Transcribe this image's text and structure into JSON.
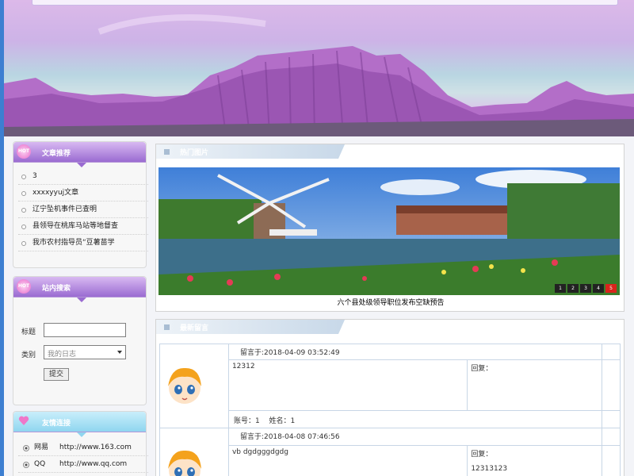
{
  "sidebar": {
    "articles": {
      "badge": "HOT",
      "title": "文章推荐",
      "items": [
        "3",
        "xxxxyyuj文章",
        "辽宁坠机事件已查明",
        "县领导在桃库马站等地督查",
        "我市农村指导员“豆薯苗学"
      ]
    },
    "search": {
      "badge": "HOT",
      "title": "站内搜索",
      "title_label": "标题",
      "title_value": "",
      "category_label": "类别",
      "category_value": "我的日志",
      "submit_label": "提交"
    },
    "links": {
      "title": "友情连接",
      "items": [
        {
          "name": "网易",
          "url": "http://www.163.com"
        },
        {
          "name": "QQ",
          "url": "http://www.qq.com"
        }
      ]
    }
  },
  "hot_pics": {
    "title": "热门图片",
    "caption": "六个县处级领导职位发布空缺预告",
    "pages": [
      "1",
      "2",
      "3",
      "4",
      "5"
    ],
    "active_page": "5"
  },
  "messages": {
    "title": "最新留言",
    "entries": [
      {
        "time_label": "留言于:2018-04-09 03:52:49",
        "content": "12312",
        "reply_label": "回复：",
        "reply": "",
        "footer": "账号：1　 姓名：1"
      },
      {
        "time_label": "留言于:2018-04-08 07:46:56",
        "content": "vb dgdgggdgdg",
        "reply_label": "回复：",
        "reply": "12313123",
        "footer": ""
      }
    ]
  },
  "colors": {
    "accent_purple": "#9a6bd1",
    "accent_blue": "#8fd6ef",
    "page_active": "#d9241c",
    "edge_blue": "#3d7fd1"
  }
}
